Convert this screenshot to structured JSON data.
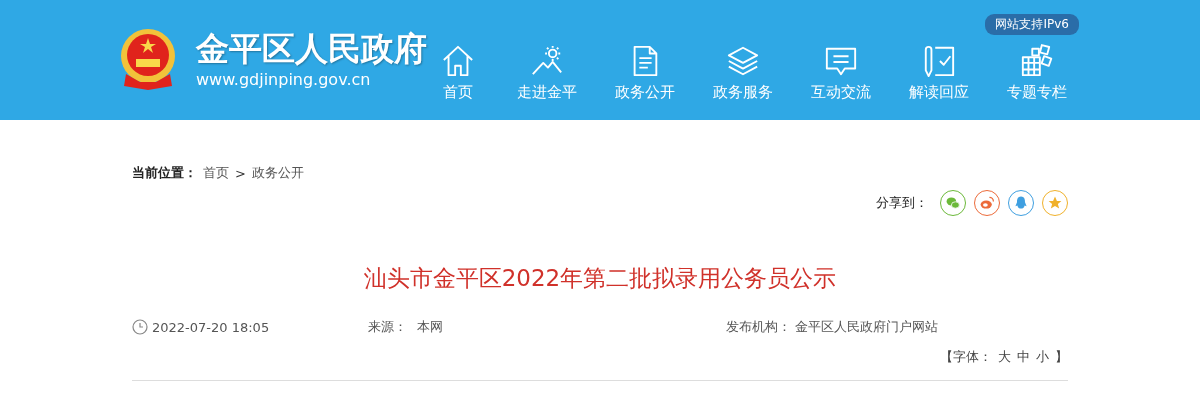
{
  "header": {
    "site_name": "金平区人民政府",
    "site_url": "www.gdjinping.gov.cn",
    "ipv6_badge": "网站支持IPv6",
    "nav": [
      {
        "label": "首页",
        "kind": "home"
      },
      {
        "label": "走进金平",
        "kind": "mountain"
      },
      {
        "label": "政务公开",
        "kind": "document"
      },
      {
        "label": "政务服务",
        "kind": "layers"
      },
      {
        "label": "互动交流",
        "kind": "message"
      },
      {
        "label": "解读回应",
        "kind": "pen"
      },
      {
        "label": "专题专栏",
        "kind": "blocks"
      }
    ]
  },
  "breadcrumb": {
    "label": "当前位置：",
    "items": [
      "首页",
      "政务公开"
    ],
    "separator": ">"
  },
  "share": {
    "label": "分享到：",
    "targets": [
      {
        "kind": "wechat",
        "color": "#6cb93a"
      },
      {
        "kind": "weibo",
        "color": "#ec6b3a"
      },
      {
        "kind": "qq",
        "color": "#3f9fe0"
      },
      {
        "kind": "star",
        "color": "#f0b12b"
      }
    ]
  },
  "article": {
    "title": "汕头市金平区2022年第二批拟录用公务员公示",
    "date": "2022-07-20 18:05",
    "source_label": "来源：",
    "source": "本网",
    "publisher_label": "发布机构：",
    "publisher": "金平区人民政府门户网站",
    "font_size": {
      "open": "【字体：",
      "options": [
        "大",
        "中",
        "小"
      ],
      "close": "】"
    }
  }
}
